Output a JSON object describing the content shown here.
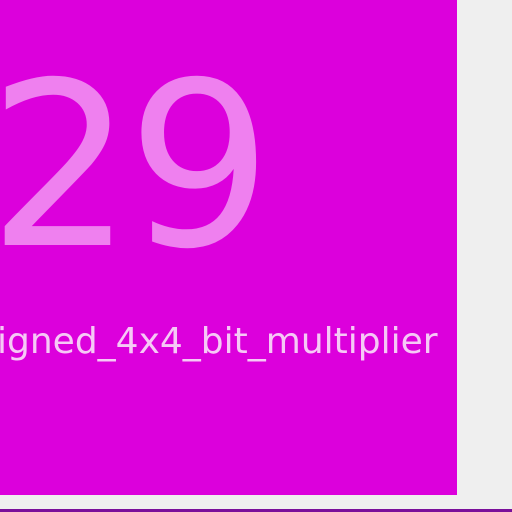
{
  "tile": {
    "number": "29",
    "label": "igned_4x4_bit_multiplier",
    "background_color": "#dc00dc",
    "number_color": "#ef80ef",
    "label_color": "#f6c9f6"
  },
  "colors": {
    "page_background": "#efefef",
    "bottom_accent": "#7a0f9a"
  }
}
